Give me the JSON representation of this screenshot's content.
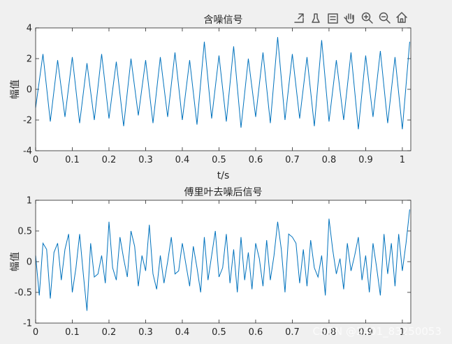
{
  "toolbar": {
    "icons": [
      "export-icon",
      "brush-icon",
      "legend-icon",
      "pan-icon",
      "zoom-in-icon",
      "zoom-out-icon",
      "home-icon"
    ]
  },
  "watermark": "CSDN @2401_83250053",
  "colors": {
    "line": "#0072bd",
    "axes_bg": "#ffffff",
    "figure_bg": "#f0f0f0"
  },
  "chart_data": [
    {
      "type": "line",
      "title": "含噪信号",
      "xlabel": "t/s",
      "ylabel": "幅值",
      "xlim": [
        0,
        1.023
      ],
      "ylim": [
        -4,
        4
      ],
      "xticks": [
        0,
        0.1,
        0.2,
        0.3,
        0.4,
        0.5,
        0.6,
        0.7,
        0.8,
        0.9,
        1
      ],
      "xtick_labels": [
        "0",
        "0.1",
        "0.2",
        "0.3",
        "0.4",
        "0.5",
        "0.6",
        "0.7",
        "0.8",
        "0.9",
        "1"
      ],
      "yticks": [
        -4,
        -2,
        0,
        2,
        4
      ],
      "ytick_labels": [
        "-4",
        "-2",
        "0",
        "2",
        "4"
      ],
      "series": [
        {
          "x": [
            0,
            0.02,
            0.04,
            0.06,
            0.08,
            0.1,
            0.12,
            0.14,
            0.16,
            0.18,
            0.2,
            0.22,
            0.24,
            0.26,
            0.28,
            0.3,
            0.32,
            0.34,
            0.36,
            0.38,
            0.4,
            0.42,
            0.44,
            0.46,
            0.48,
            0.5,
            0.52,
            0.54,
            0.56,
            0.58,
            0.6,
            0.62,
            0.64,
            0.66,
            0.68,
            0.7,
            0.72,
            0.74,
            0.76,
            0.78,
            0.8,
            0.82,
            0.84,
            0.86,
            0.88,
            0.9,
            0.92,
            0.94,
            0.96,
            0.98,
            1.0,
            1.02
          ],
          "y": [
            -1.2,
            2.3,
            -2.1,
            1.9,
            -1.8,
            2.1,
            -2.2,
            1.7,
            -2.0,
            2.3,
            -1.9,
            1.8,
            -2.4,
            2.0,
            -1.7,
            1.9,
            -2.2,
            2.1,
            -1.8,
            2.4,
            -2.0,
            1.9,
            -2.3,
            3.1,
            -1.9,
            2.2,
            -2.1,
            2.8,
            -2.5,
            2.0,
            -1.8,
            2.4,
            -2.2,
            3.4,
            -2.0,
            2.3,
            -1.9,
            2.1,
            -2.4,
            3.2,
            -2.1,
            1.9,
            -2.0,
            2.4,
            -2.6,
            2.2,
            -1.8,
            2.5,
            -2.2,
            2.1,
            -2.6,
            3.1
          ]
        }
      ]
    },
    {
      "type": "line",
      "title": "傅里叶去噪后信号",
      "xlabel": "",
      "ylabel": "幅值",
      "xlim": [
        0,
        1.023
      ],
      "ylim": [
        -1,
        1
      ],
      "xticks": [
        0,
        0.1,
        0.2,
        0.3,
        0.4,
        0.5,
        0.6,
        0.7,
        0.8,
        0.9,
        1
      ],
      "xtick_labels": [
        "0",
        "0.1",
        "0.2",
        "0.3",
        "0.4",
        "0.5",
        "0.6",
        "0.7",
        "0.8",
        "0.9",
        "1"
      ],
      "yticks": [
        -1,
        -0.5,
        0,
        0.5,
        1
      ],
      "ytick_labels": [
        "-1",
        "-0.5",
        "0",
        "0.5",
        "1"
      ],
      "series": [
        {
          "x": [
            0.0,
            0.01,
            0.02,
            0.03,
            0.04,
            0.05,
            0.06,
            0.07,
            0.08,
            0.09,
            0.1,
            0.11,
            0.12,
            0.13,
            0.14,
            0.15,
            0.16,
            0.17,
            0.18,
            0.19,
            0.2,
            0.21,
            0.22,
            0.23,
            0.24,
            0.25,
            0.26,
            0.27,
            0.28,
            0.29,
            0.3,
            0.31,
            0.32,
            0.33,
            0.34,
            0.35,
            0.36,
            0.37,
            0.38,
            0.39,
            0.4,
            0.41,
            0.42,
            0.43,
            0.44,
            0.45,
            0.46,
            0.47,
            0.48,
            0.49,
            0.5,
            0.51,
            0.52,
            0.53,
            0.54,
            0.55,
            0.56,
            0.57,
            0.58,
            0.59,
            0.6,
            0.61,
            0.62,
            0.63,
            0.64,
            0.65,
            0.66,
            0.67,
            0.68,
            0.69,
            0.7,
            0.71,
            0.72,
            0.73,
            0.74,
            0.75,
            0.76,
            0.77,
            0.78,
            0.79,
            0.8,
            0.81,
            0.82,
            0.83,
            0.84,
            0.85,
            0.86,
            0.87,
            0.88,
            0.89,
            0.9,
            0.91,
            0.92,
            0.93,
            0.94,
            0.95,
            0.96,
            0.97,
            0.98,
            0.99,
            1.0,
            1.01,
            1.02
          ],
          "y": [
            0.1,
            -0.55,
            0.3,
            0.2,
            -0.6,
            0.15,
            0.3,
            -0.3,
            0.2,
            0.45,
            -0.5,
            -0.1,
            0.45,
            -0.2,
            -0.8,
            0.3,
            -0.25,
            -0.2,
            0.1,
            -0.35,
            0.65,
            -0.1,
            -0.3,
            0.4,
            0.05,
            -0.25,
            0.5,
            0.25,
            -0.4,
            0.1,
            -0.15,
            0.6,
            -0.2,
            -0.45,
            0.1,
            -0.35,
            0.0,
            0.4,
            -0.2,
            -0.15,
            0.3,
            -0.05,
            -0.4,
            0.25,
            -0.1,
            -0.5,
            0.4,
            -0.3,
            0.1,
            0.5,
            -0.25,
            -0.1,
            0.45,
            -0.35,
            0.2,
            -0.5,
            0.4,
            -0.3,
            0.15,
            -0.45,
            0.3,
            0.05,
            -0.4,
            0.35,
            -0.3,
            0.1,
            0.65,
            0.2,
            -0.5,
            0.45,
            0.4,
            0.3,
            -0.35,
            0.2,
            -0.4,
            0.35,
            -0.1,
            -0.25,
            0.1,
            -0.55,
            0.7,
            0.2,
            -0.2,
            0.05,
            -0.45,
            0.3,
            -0.15,
            0.1,
            0.4,
            -0.3,
            0.1,
            -0.5,
            0.3,
            -0.1,
            -0.55,
            0.45,
            -0.2,
            0.3,
            -0.4,
            0.45,
            -0.15,
            0.3,
            0.85
          ]
        }
      ]
    }
  ]
}
